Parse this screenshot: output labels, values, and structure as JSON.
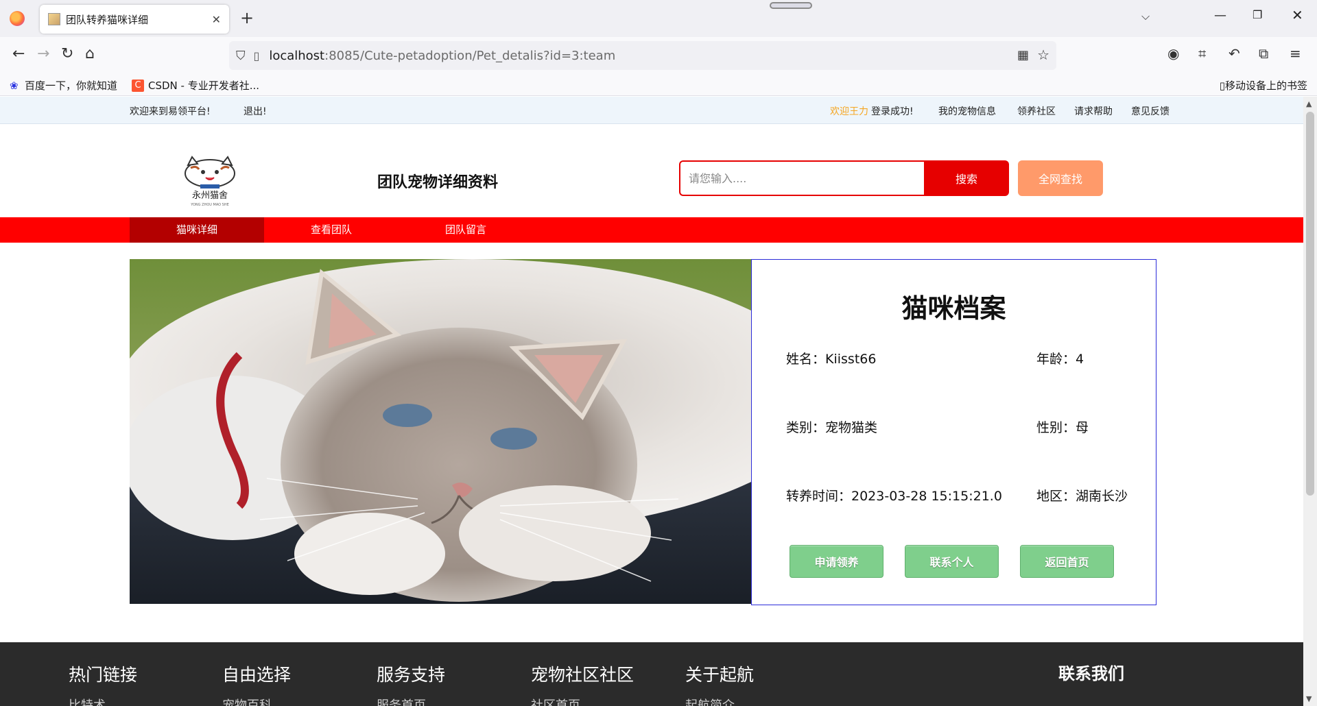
{
  "browser": {
    "tab_title": "团队转养猫咪详细",
    "url_host": "localhost",
    "url_rest": ":8085/Cute-petadoption/Pet_detalis?id=3:team",
    "bookmarks": [
      "百度一下，你就知道",
      "CSDN - 专业开发者社..."
    ],
    "mobile_bookmarks": "移动设备上的书签"
  },
  "topbar": {
    "welcome": "欢迎来到易领平台!",
    "logout": "退出!",
    "user_greeting": "欢迎王力",
    "login_success": "登录成功!",
    "links": [
      "我的宠物信息",
      "领养社区",
      "请求帮助",
      "意见反馈"
    ]
  },
  "header": {
    "logo_text": "永州猫舍",
    "logo_sub": "YONG ZHOU MAO SHE",
    "title": "团队宠物详细资料",
    "search_placeholder": "请您输入....",
    "search_button": "搜索",
    "web_search_button": "全网查找"
  },
  "nav_tabs": [
    "猫咪详细",
    "查看团队",
    "团队留言"
  ],
  "profile": {
    "title": "猫咪档案",
    "name": "姓名：Kiisst66",
    "age": "年龄：4",
    "category": "类别：宠物猫类",
    "gender": "性别：母",
    "time": "转养时间：2023-03-28 15:15:21.0",
    "region": "地区：湖南长沙",
    "buttons": [
      "申请领养",
      "联系个人",
      "返回首页"
    ]
  },
  "footer": {
    "columns": [
      "热门链接",
      "自由选择",
      "服务支持",
      "宠物社区社区",
      "关于起航"
    ],
    "sub_items": [
      "比特术",
      "宠物百科",
      "服务首页",
      "社区首页",
      "起航简介"
    ],
    "contact": "联系我们"
  },
  "colors": {
    "accent_red": "#ff0000",
    "active_tab": "#b30000",
    "web_search": "#ff9a6a",
    "action_green": "#7fcf8c",
    "profile_border": "#2b2bd9"
  }
}
